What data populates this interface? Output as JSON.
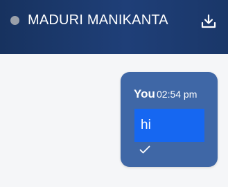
{
  "header": {
    "contact_name": "MADURI MANIKANTA",
    "status_color": "#9aa0aa",
    "download_icon": "download-icon"
  },
  "message": {
    "sender": "You",
    "time": "02:54 pm",
    "text": "hi",
    "status_icon": "check-icon",
    "bubble_color": "#3f67a6",
    "text_box_color": "#1667f1"
  }
}
